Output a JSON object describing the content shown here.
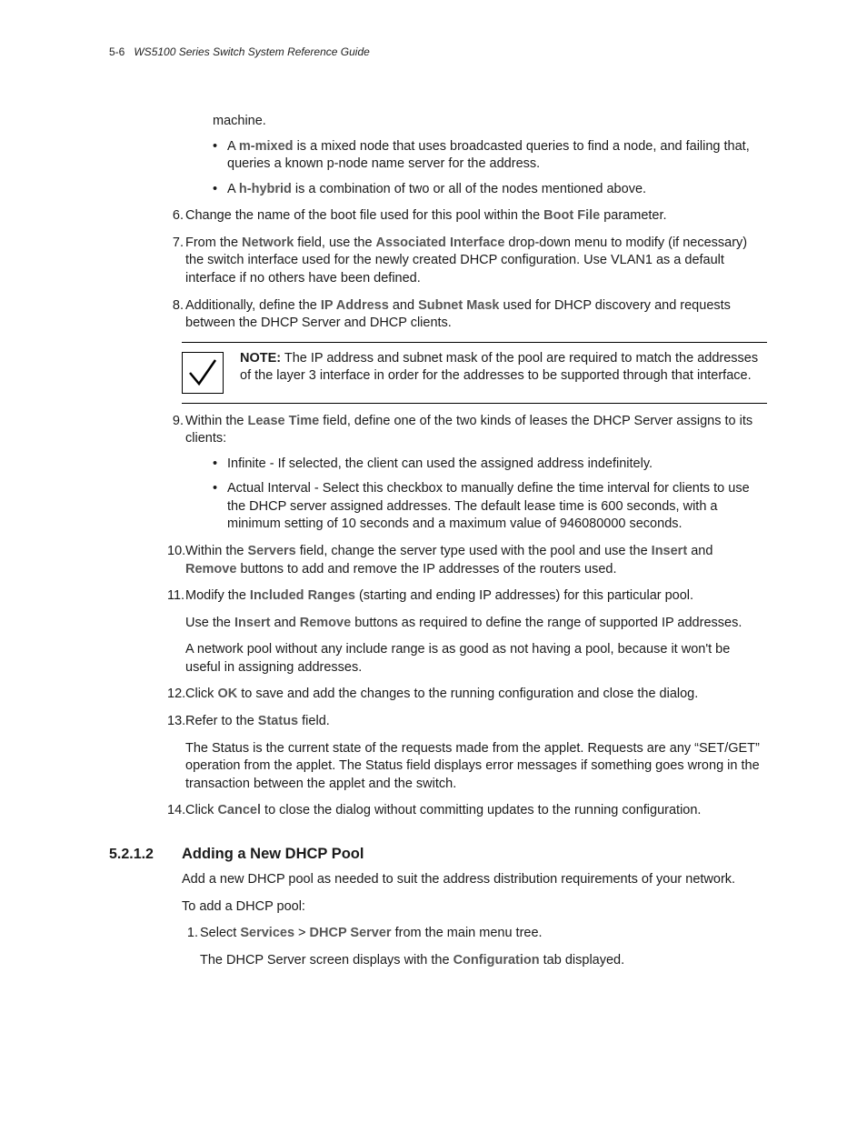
{
  "header": {
    "page_ref": "5-6",
    "doc_title": "WS5100 Series Switch System Reference Guide"
  },
  "orphan_line": "machine.",
  "bullets_top": [
    {
      "prefix": "A ",
      "term": "m-mixed",
      "rest": " is a mixed node that uses broadcasted queries to find a node, and failing that, queries a known p-node name server for the address."
    },
    {
      "prefix": "A ",
      "term": "h-hybrid",
      "rest": " is a combination of two or all of the nodes mentioned above."
    }
  ],
  "steps": {
    "6": {
      "pre": "Change the name of the boot file used for this pool within the ",
      "t1": "Boot File",
      "post": " parameter."
    },
    "7": {
      "pre": "From the ",
      "t1": "Network",
      "mid1": " field, use the ",
      "t2": "Associated Interface",
      "post": " drop-down menu to modify (if necessary) the switch interface used for the newly created DHCP configuration. Use VLAN1 as a default interface if no others have been defined."
    },
    "8": {
      "pre": "Additionally, define the ",
      "t1": "IP Address",
      "mid1": " and ",
      "t2": "Subnet Mask",
      "post": " used for DHCP discovery and requests between the DHCP Server and DHCP clients."
    },
    "9": {
      "pre": "Within the ",
      "t1": "Lease Time",
      "post": " field, define one of the two kinds of leases the DHCP Server assigns to its clients:",
      "bullets": [
        "Infinite - If selected, the client can used the assigned address indefinitely.",
        "Actual Interval - Select this checkbox to manually define the time interval for clients to use the DHCP server assigned addresses. The default lease time is 600 seconds, with a minimum setting of 10 seconds and a maximum value of 946080000 seconds."
      ]
    },
    "10": {
      "pre": "Within the ",
      "t1": "Servers",
      "mid1": " field, change the server type used with the pool and use the ",
      "t2": "Insert",
      "mid2": " and ",
      "t3": "Remove",
      "post": " buttons to add and remove the IP addresses of the routers used."
    },
    "11": {
      "pre": "Modify the ",
      "t1": "Included Ranges",
      "post": " (starting and ending IP addresses) for this particular pool.",
      "p1_pre": "Use the ",
      "p1_t1": "Insert",
      "p1_mid": " and ",
      "p1_t2": "Remove",
      "p1_post": " buttons as required to define the range of supported IP addresses.",
      "p2": "A network pool without any include range is as good as not having a pool, because it won't be useful in assigning addresses."
    },
    "12": {
      "pre": "Click ",
      "t1": "OK",
      "post": " to save and add the changes to the running configuration and close the dialog."
    },
    "13": {
      "pre": "Refer to the ",
      "t1": "Status",
      "post": " field.",
      "p1": "The Status is the current state of the requests made from the applet. Requests are any “SET/GET” operation from the applet. The Status field displays error messages if something goes wrong in the transaction between the applet and the switch."
    },
    "14": {
      "pre": "Click ",
      "t1": "Cancel",
      "post": " to close the dialog without committing updates to the running configuration."
    }
  },
  "note": {
    "label": "NOTE:",
    "text": " The IP address and subnet mask of the pool are required to match the addresses of the layer 3 interface in order for the addresses to be supported through that interface."
  },
  "section": {
    "num": "5.2.1.2",
    "title": "Adding a New DHCP Pool",
    "intro": "Add a new DHCP pool as needed to suit the address distribution requirements of your network.",
    "lead": "To add a DHCP pool:",
    "step1": {
      "pre": "Select ",
      "t1": "Services",
      "gt": " > ",
      "t2": "DHCP Server",
      "post": " from the main menu tree.",
      "sub_pre": "The DHCP Server screen displays with the ",
      "sub_t": "Configuration",
      "sub_post": " tab displayed."
    }
  }
}
